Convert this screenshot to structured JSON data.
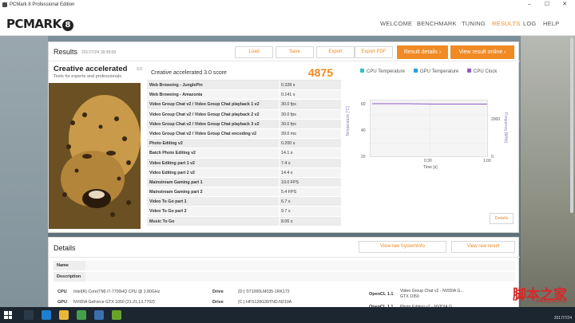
{
  "window": {
    "title": "PCMark 8 Professional Edition"
  },
  "nav": {
    "logo": "PCMARK",
    "logo_badge": "8",
    "items": [
      {
        "label": "WELCOME",
        "active": false
      },
      {
        "label": "BENCHMARK",
        "active": false
      },
      {
        "label": "TUNING",
        "active": false
      },
      {
        "label": "RESULTS",
        "active": true
      },
      {
        "label": "LOG",
        "active": false
      },
      {
        "label": "HELP",
        "active": false
      }
    ]
  },
  "results": {
    "title": "Results",
    "date": "2017/7/24 18:39:09",
    "buttons": {
      "load": "Load",
      "save": "Save",
      "export": "Export",
      "export_pdf": "Export PDF",
      "details": "Result details",
      "online": "View result online"
    },
    "test_name": "Creative accelerated",
    "test_version": "3.0",
    "test_subtitle": "Tests for experts and professionals",
    "score_label": "Creative accelerated 3.0 score",
    "score_value": "4875",
    "subtests": [
      {
        "name": "Web Browsing - JunglePin",
        "value": "0.328 s"
      },
      {
        "name": "Web Browsing - Amazonia",
        "value": "0.141 s"
      },
      {
        "name": "Video Group Chat v2 / Video Group Chat playback 1 v2",
        "value": "30.0 fps"
      },
      {
        "name": "Video Group Chat v2 / Video Group Chat playback 2 v2",
        "value": "30.0 fps"
      },
      {
        "name": "Video Group Chat v2 / Video Group Chat playback 3 v2",
        "value": "30.0 fps"
      },
      {
        "name": "Video Group Chat v2 / Video Group Chat encoding v2",
        "value": "39.0 ms"
      },
      {
        "name": "Photo Editing v2",
        "value": "0.200 s"
      },
      {
        "name": "Batch Photo Editing v2",
        "value": "14.1 s"
      },
      {
        "name": "Video Editing part 1 v2",
        "value": "7.4 s"
      },
      {
        "name": "Video Editing part 2 v2",
        "value": "14.4 s"
      },
      {
        "name": "Mainstream Gaming part 1",
        "value": "10.0 FPS"
      },
      {
        "name": "Mainstream Gaming part 2",
        "value": "5.4 FPS"
      },
      {
        "name": "Video To Go part 1",
        "value": "6.7 s"
      },
      {
        "name": "Video To Go part 2",
        "value": "9.7 s"
      },
      {
        "name": "Music To Go",
        "value": "8.06 s"
      }
    ],
    "graph": {
      "legend": [
        {
          "label": "CPU Temperature",
          "color": "#2ec4c4"
        },
        {
          "label": "GPU Temperature",
          "color": "#2e9fd8"
        },
        {
          "label": "CPU Clock",
          "color": "#8e5cc8"
        }
      ],
      "y_left_label": "Temperature [°C]",
      "y_right_label": "Frequency [MHz]",
      "x_label": "Time [s]",
      "y_left_ticks": [
        "60",
        "40",
        "20"
      ],
      "y_right_ticks": [
        "2000",
        "0"
      ],
      "x_ticks": [
        "0:30",
        "1:00"
      ],
      "details_button": "Details"
    }
  },
  "details": {
    "title": "Details",
    "view_systeminfo": "View raw SystemInfo",
    "view_result": "View raw result",
    "name_label": "Name",
    "description_label": "Description",
    "cpu_label": "CPU",
    "cpu_value": "Intel(R) Core(TM) i7-7700HQ CPU @ 2.80GHz",
    "gpu_label": "GPU",
    "gpu_value": "NVIDIA GeForce GTX 1050 (21.21.13.7702)",
    "drive1_label": "Drive",
    "drive1_value": "(D:) ST1000LM035-1RK172",
    "drive2_label": "Drive",
    "drive2_value": "(C:) HFS128G39TND-N210A",
    "opencl1_label": "OpenCL 1.1",
    "opencl1_value_a": "Video Group Chat v2 - NVIDIA G...",
    "opencl1_value_b": "GTX 1050",
    "opencl2_label": "OpenCL 1.1",
    "opencl2_value": "Photo Editing v2 - NVIDIA G..."
  },
  "taskbar": {
    "date": "2017/7/24"
  },
  "watermark": {
    "text": "脚本之家",
    "url": "www.jb51.net"
  }
}
